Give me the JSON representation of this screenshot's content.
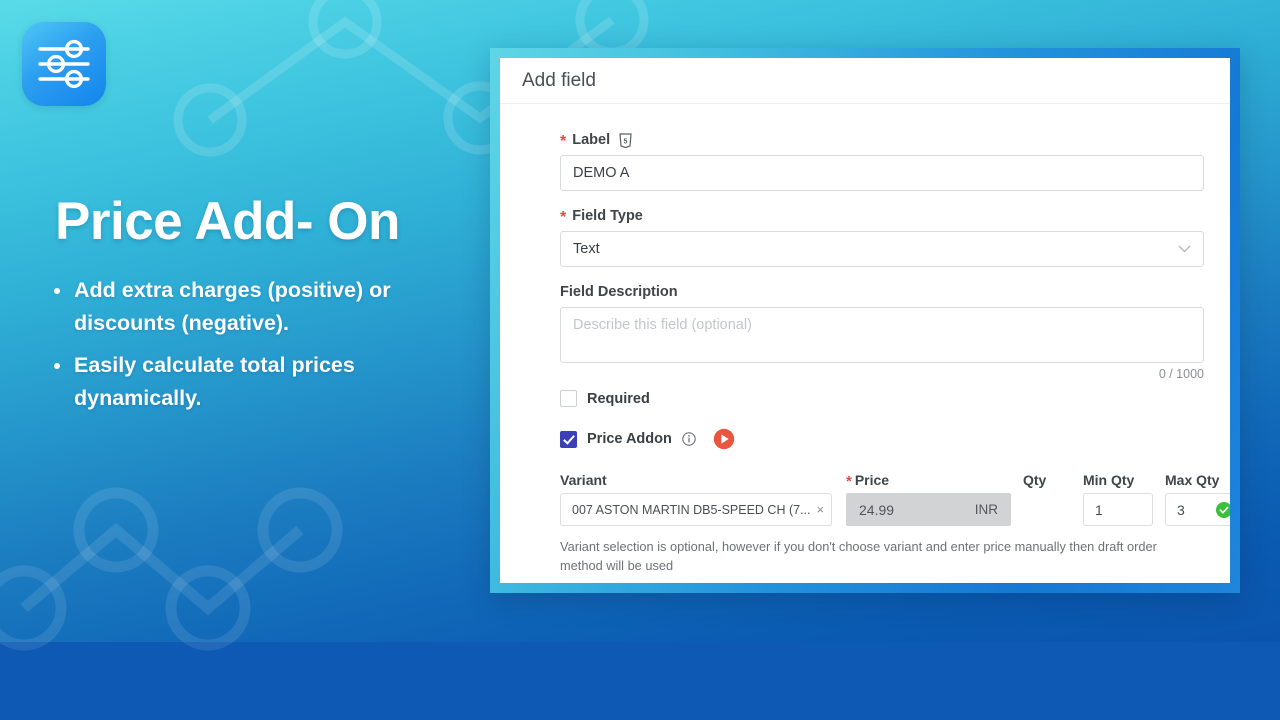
{
  "brand": {
    "logo_icon": "sliders-icon",
    "accent_cyan": "#5adbe8",
    "accent_blue": "#0b55b0",
    "checkbox_blue": "#3c40b8",
    "required_red": "#e8483f",
    "play_orange": "#e8563f",
    "ok_green": "#3ac13a"
  },
  "promo": {
    "headline": "Price Add- On",
    "bullets": [
      "Add extra charges (positive) or discounts (negative).",
      "Easily calculate total prices dynamically."
    ]
  },
  "card": {
    "header_title": "Add field",
    "label_field": {
      "label": "Label",
      "required_marker": "*",
      "icon": "html5-icon",
      "value": "DEMO A"
    },
    "field_type": {
      "label": "Field Type",
      "required_marker": "*",
      "value": "Text",
      "chevron": "chevron-down-icon"
    },
    "field_description": {
      "label": "Field Description",
      "placeholder": "Describe this field (optional)",
      "value": "",
      "counter": "0 / 1000"
    },
    "required_checkbox": {
      "label": "Required",
      "checked": false
    },
    "price_addon_checkbox": {
      "label": "Price Addon",
      "checked": true,
      "info_icon": "info-icon",
      "play_icon": "play-button-icon"
    },
    "variant_table": {
      "headers": {
        "variant": "Variant",
        "price": "Price",
        "price_required_marker": "*",
        "qty": "Qty",
        "min_qty": "Min Qty",
        "max_qty": "Max Qty"
      },
      "row": {
        "variant_value": "007 ASTON MARTIN DB5-SPEED CH (7...",
        "variant_clear": "×",
        "price_value": "24.99",
        "currency": "INR",
        "qty_checked": true,
        "min_qty_value": "1",
        "max_qty_value": "3",
        "max_qty_status": "valid-check-icon"
      }
    },
    "helper_text": "Variant selection is optional, however if you don't choose variant and enter price manually then draft order method will be used"
  }
}
